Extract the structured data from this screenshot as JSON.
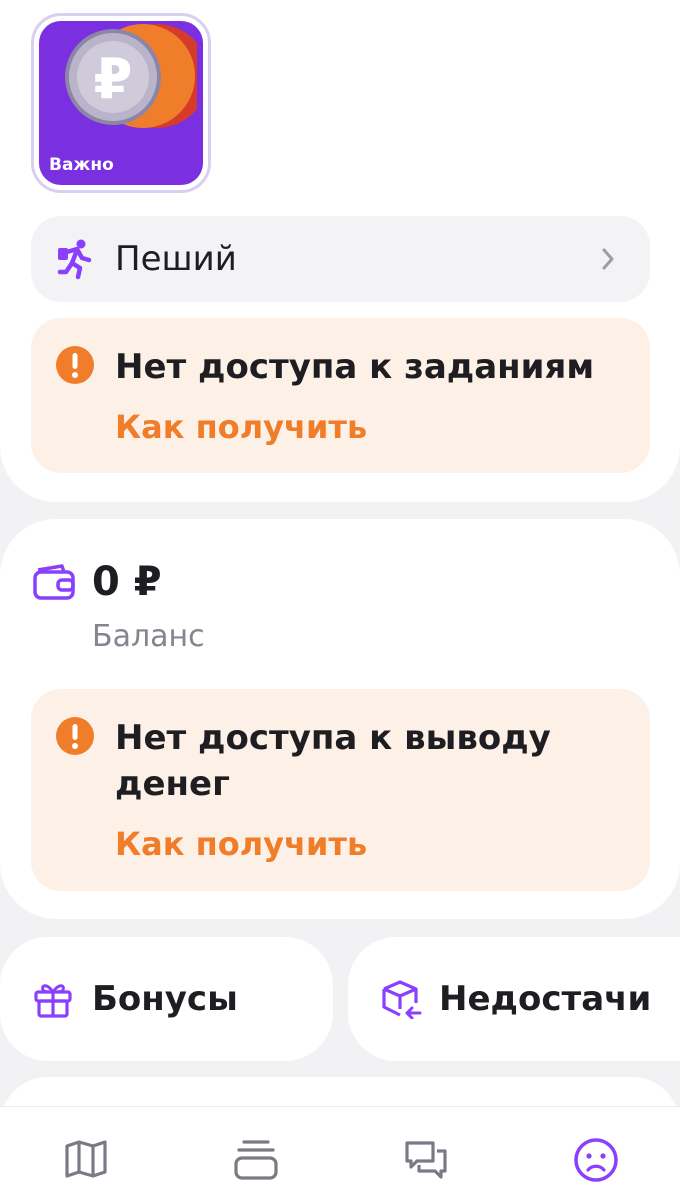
{
  "story": {
    "label": "Важно"
  },
  "profile_row": {
    "label": "Пеший",
    "icon": "walker-icon"
  },
  "warnings": [
    {
      "title": "Нет доступа к заданиям",
      "link": "Как получить"
    },
    {
      "title": "Нет доступа к выводу денег",
      "link": "Как получить"
    }
  ],
  "balance": {
    "value": "0 ₽",
    "label": "Баланс"
  },
  "tiles": [
    {
      "label": "Бонусы",
      "icon": "gift-icon"
    },
    {
      "label": "Недостачи",
      "icon": "box-return-icon"
    }
  ],
  "tabbar": {
    "items": [
      {
        "icon": "map-icon"
      },
      {
        "icon": "stack-icon"
      },
      {
        "icon": "chat-icon"
      },
      {
        "icon": "profile-icon",
        "active": true
      }
    ]
  },
  "colors": {
    "accent": "#8a3ffc",
    "warning_bg": "#fdf0e6",
    "warning_orange": "#f07d2a",
    "muted_text": "#85858f"
  }
}
